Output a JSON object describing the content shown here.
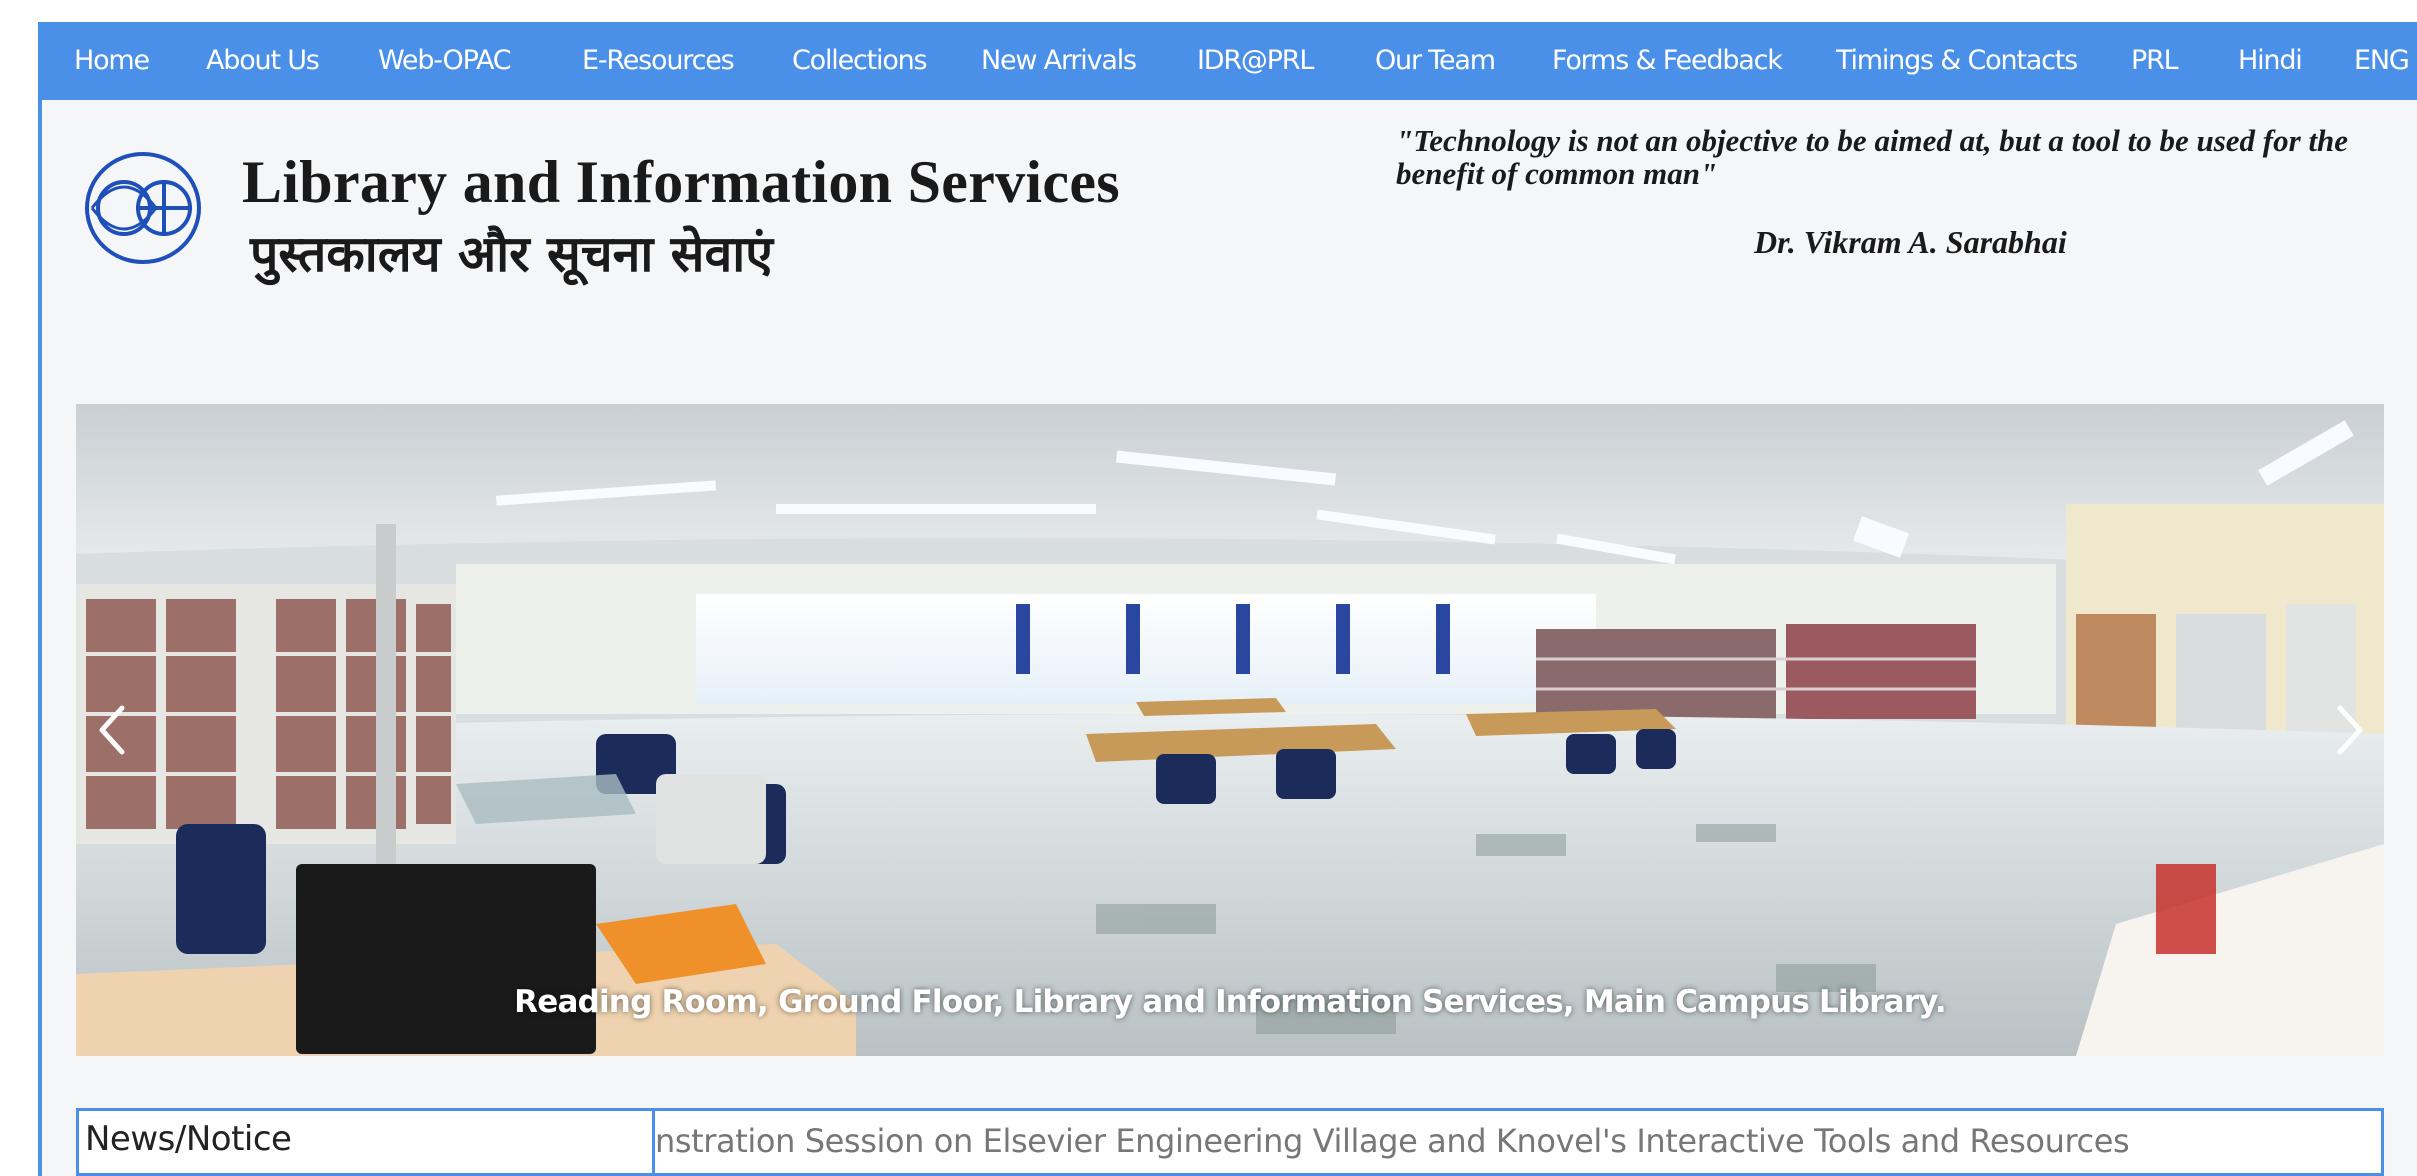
{
  "nav": {
    "items": [
      {
        "label": "Home"
      },
      {
        "label": "About Us"
      },
      {
        "label": "Web-OPAC"
      },
      {
        "label": "E-Resources"
      },
      {
        "label": "Collections"
      },
      {
        "label": "New Arrivals"
      },
      {
        "label": "IDR@PRL"
      },
      {
        "label": "Our Team"
      },
      {
        "label": "Forms & Feedback"
      },
      {
        "label": "Timings & Contacts"
      },
      {
        "label": "PRL"
      },
      {
        "label": "Hindi"
      },
      {
        "label": "ENG"
      }
    ]
  },
  "header": {
    "title_en": "Library and Information Services",
    "title_hi": "पुस्तकालय और सूचना सेवाएं",
    "quote": "\"Technology is not an objective to be aimed at, but a tool to be used for the benefit of common man\"",
    "quote_author": "Dr. Vikram A. Sarabhai"
  },
  "carousel": {
    "caption": "Reading Room, Ground Floor, Library and Information Services, Main Campus Library.",
    "prev_icon": "chevron-left-icon",
    "next_icon": "chevron-right-icon"
  },
  "news": {
    "label": "News/Notice",
    "ticker_text": "nstration Session on Elsevier Engineering Village and Knovel's Interactive Tools and Resources"
  },
  "colors": {
    "accent": "#4a8fe8",
    "page_bg": "#f5f6f8",
    "text": "#1a1a1a"
  }
}
